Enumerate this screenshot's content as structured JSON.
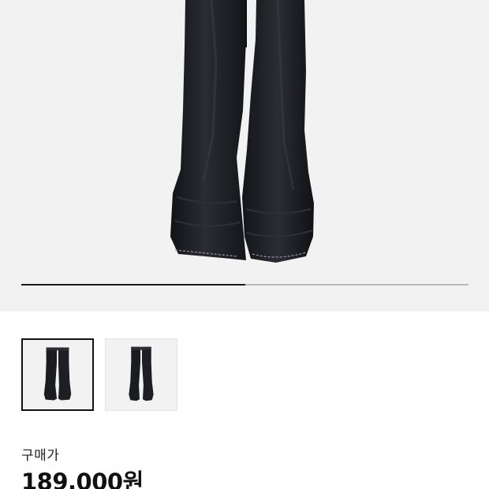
{
  "product": {
    "main_image": "pants-photo",
    "thumbnail_icon": "pants-thumbnail",
    "image_count": 2,
    "current_image": 1,
    "colors": {
      "hero_background": "#f2f2f2",
      "pants": "#1b1c20",
      "stitching": "#8a8f9a"
    }
  },
  "gallery": {
    "progress_fraction": 0.5,
    "thumbnails": [
      {
        "selected": true
      },
      {
        "selected": false
      }
    ]
  },
  "pricing": {
    "label": "구매가",
    "price": "189,000원"
  }
}
